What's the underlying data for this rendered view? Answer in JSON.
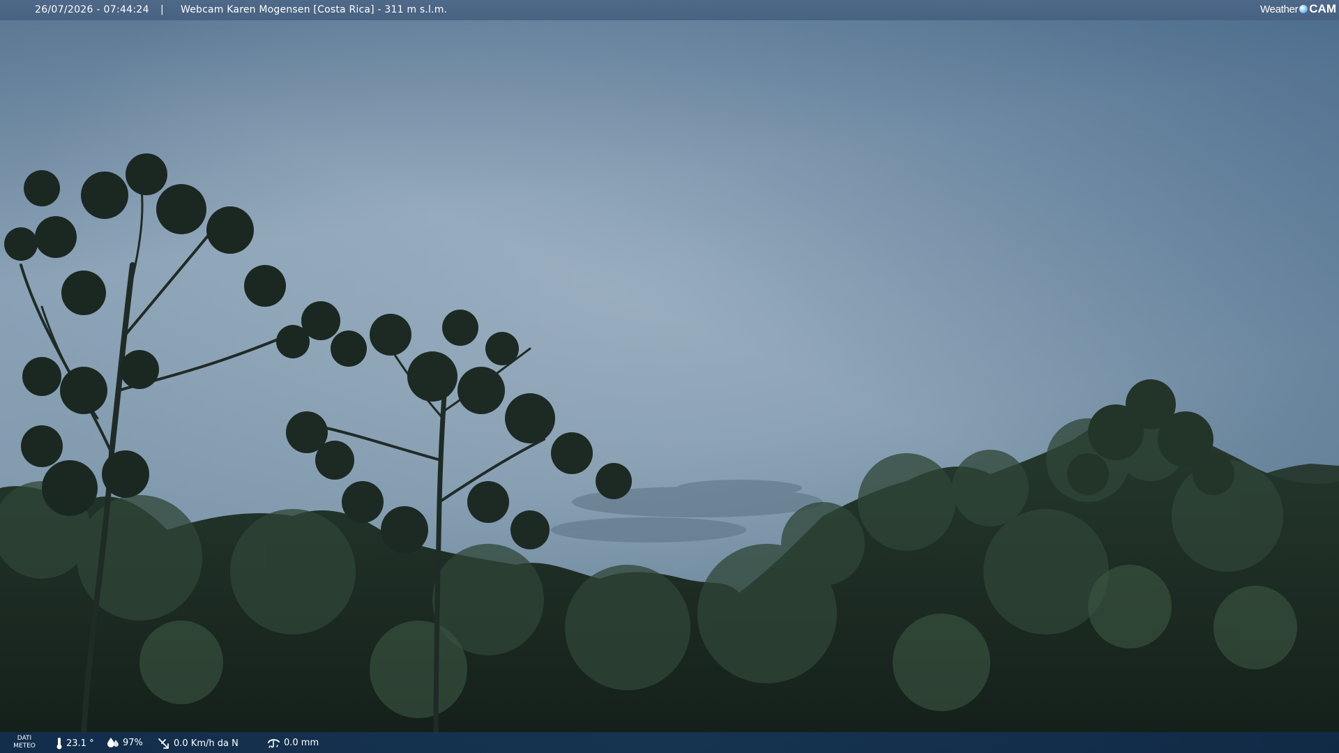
{
  "top_bar": {
    "datetime": "26/07/2026 - 07:44:24",
    "separator": "|",
    "location": "Webcam Karen Mogensen [Costa Rica]  - 311 m s.l.m.",
    "brand_weather": "Weather",
    "brand_cam": "CAM"
  },
  "bottom_bar": {
    "dati_line1": "DATI",
    "dati_line2": "METEO",
    "temperature": "23.1 °",
    "humidity": "97%",
    "wind": "0.0 Km/h da N",
    "rain": "0.0 mm"
  },
  "icons": {
    "temperature": "thermometer-icon",
    "humidity": "humidity-drop-icon",
    "wind": "wind-icon",
    "rain": "rain-icon",
    "brand": "globe-icon"
  },
  "colors": {
    "sky_top": "#4f6c8a",
    "sky_mid": "#8ea5b8",
    "foliage": "#1d2b24",
    "bar_top": "#4e6888",
    "bar_bottom": "#16385e"
  }
}
